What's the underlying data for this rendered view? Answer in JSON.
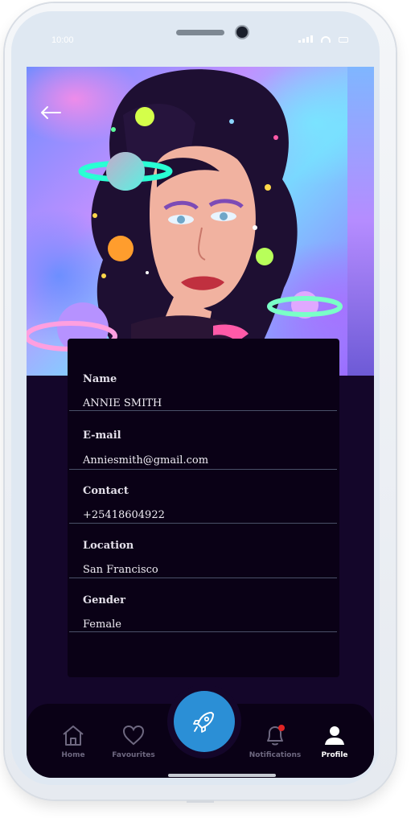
{
  "status_bar": {
    "time": "10:00"
  },
  "header": {
    "back_icon": "arrow-left-icon"
  },
  "profile": {
    "fields": [
      {
        "label": "Name",
        "value": "ANNIE SMITH"
      },
      {
        "label": "E-mail",
        "value": "Anniesmith@gmail.com"
      },
      {
        "label": "Contact",
        "value": "+25418604922"
      },
      {
        "label": "Location",
        "value": "San Francisco"
      },
      {
        "label": "Gender",
        "value": "Female"
      }
    ]
  },
  "nav": {
    "items": [
      {
        "label": "Home",
        "icon": "home-icon"
      },
      {
        "label": "Favourites",
        "icon": "heart-icon"
      },
      {
        "label": "Notifications",
        "icon": "bell-icon"
      },
      {
        "label": "Profile",
        "icon": "user-icon"
      }
    ],
    "active": "Profile",
    "fab_icon": "rocket-icon"
  },
  "colors": {
    "background": "#14062a",
    "card": "#0a0116",
    "accent": "#2b8fd6",
    "notification_dot": "#e02424"
  }
}
